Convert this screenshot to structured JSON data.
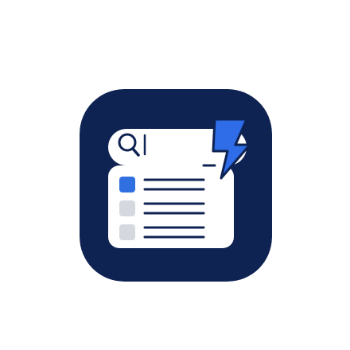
{
  "icon": {
    "name": "quick-search-app-icon",
    "glyphs": [
      "search-icon",
      "lightning-bolt-icon",
      "result-list-icon"
    ],
    "colors": {
      "tile": "#0F2352",
      "panel": "#FFFFFF",
      "accent": "#2F6FE0",
      "bolt": "#2E6CE8",
      "placeholder": "#D5D8DE",
      "lines": "#0F2352"
    }
  },
  "results": {
    "rows": [
      {
        "state": "selected"
      },
      {
        "state": "unselected"
      },
      {
        "state": "unselected"
      }
    ]
  }
}
